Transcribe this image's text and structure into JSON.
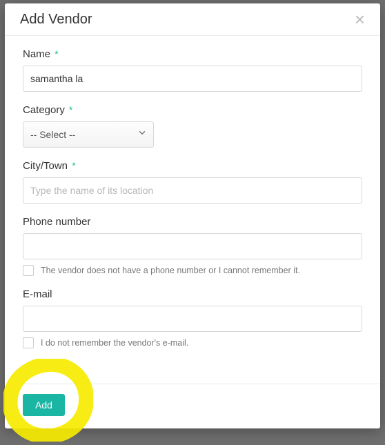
{
  "modal": {
    "title": "Add Vendor",
    "close_label": "×"
  },
  "fields": {
    "name": {
      "label": "Name",
      "required": true,
      "value": "samantha la"
    },
    "category": {
      "label": "Category",
      "required": true,
      "selected": "-- Select --"
    },
    "city": {
      "label": "City/Town",
      "required": true,
      "placeholder": "Type the name of its location",
      "value": ""
    },
    "phone": {
      "label": "Phone number",
      "required": false,
      "value": "",
      "checkbox_label": "The vendor does not have a phone number or I cannot remember it."
    },
    "email": {
      "label": "E-mail",
      "required": false,
      "value": "",
      "checkbox_label": "I do not remember the vendor's e-mail."
    }
  },
  "footer": {
    "add_label": "Add"
  },
  "icons": {
    "asterisk": "*"
  }
}
